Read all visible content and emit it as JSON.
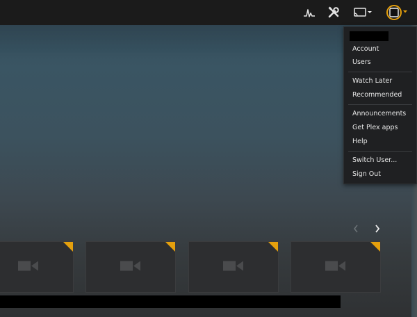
{
  "topbar": {
    "icons": [
      "activity-icon",
      "settings-tools-icon",
      "cast-icon",
      "avatar-icon"
    ],
    "colors": {
      "accent": "#e5a00d",
      "background": "#1b1b1b"
    }
  },
  "user_menu": {
    "username_redacted": true,
    "items": [
      {
        "label": "Account"
      },
      {
        "label": "Users"
      },
      {
        "label": "Watch Later"
      },
      {
        "label": "Recommended"
      },
      {
        "label": "Announcements"
      },
      {
        "label": "Get Plex apps"
      },
      {
        "label": "Help"
      },
      {
        "label": "Switch User..."
      },
      {
        "label": "Sign Out"
      }
    ]
  },
  "carousel": {
    "prev_icon": "chevron-left-icon",
    "next_icon": "chevron-right-icon",
    "cards": [
      {
        "icon": "video-camera-icon"
      },
      {
        "icon": "video-camera-icon"
      },
      {
        "icon": "video-camera-icon"
      },
      {
        "icon": "video-camera-icon"
      }
    ]
  }
}
